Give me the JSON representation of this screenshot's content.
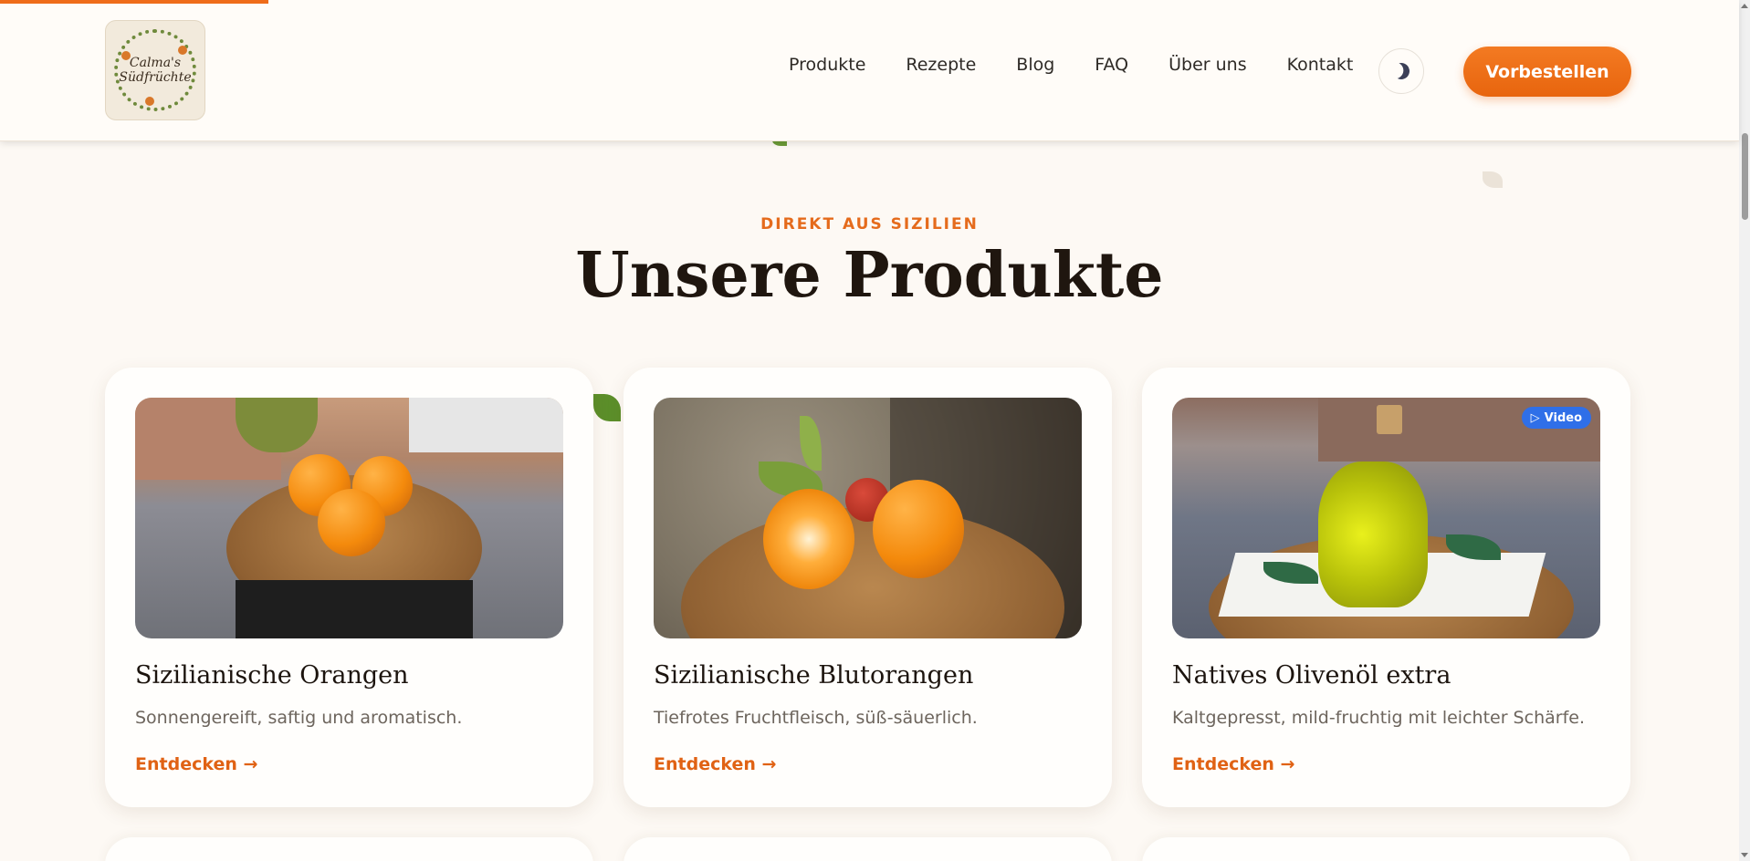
{
  "header": {
    "logo_text": "Calma's\nSüdfrüchte",
    "nav": [
      "Produkte",
      "Rezepte",
      "Blog",
      "FAQ",
      "Über uns",
      "Kontakt"
    ],
    "theme_toggle_icon": "moon-icon",
    "cta_label": "Vorbestellen"
  },
  "section": {
    "eyebrow": "DIREKT AUS SIZILIEN",
    "title": "Unsere Produkte"
  },
  "products": [
    {
      "title": "Sizilianische Orangen",
      "description": "Sonnengereift, saftig und aromatisch.",
      "link": "Entdecken →"
    },
    {
      "title": "Sizilianische Blutorangen",
      "description": "Tiefrotes Fruchtfleisch, süß-säuerlich.",
      "link": "Entdecken →"
    },
    {
      "title": "Natives Olivenöl extra",
      "description": "Kaltgepresst, mild-fruchtig mit leichter Schärfe.",
      "link": "Entdecken →",
      "badge": "Video"
    }
  ],
  "colors": {
    "accent": "#e8650e",
    "background": "#fdf9f4",
    "badge": "#2f6fe8"
  }
}
